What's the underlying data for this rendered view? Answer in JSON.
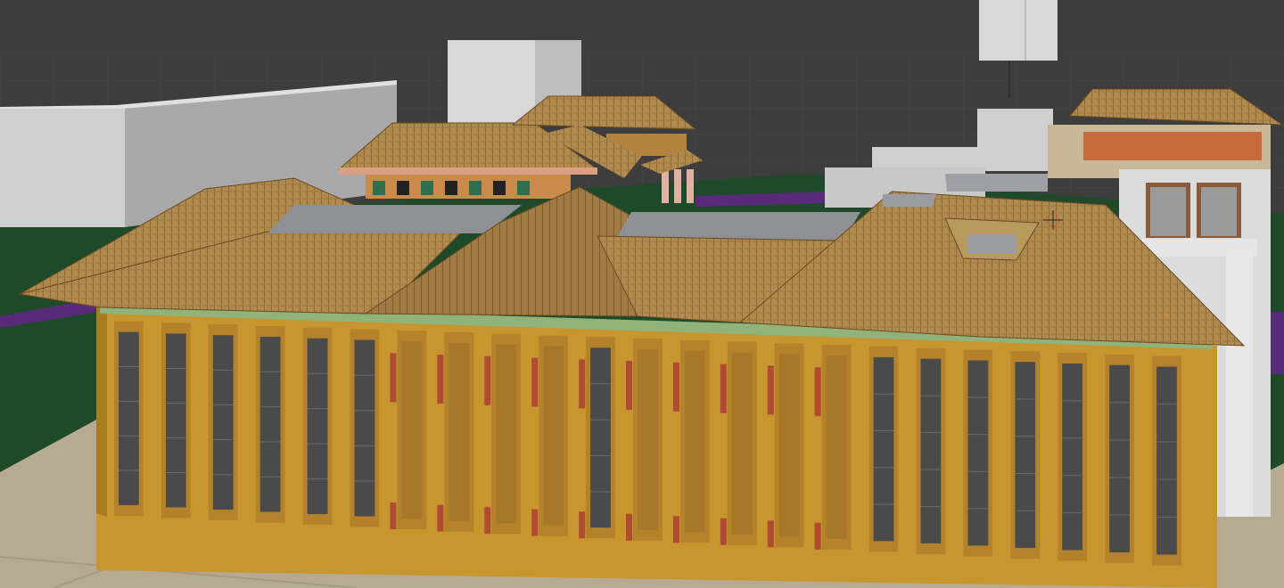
{
  "app": {
    "name": "3D viewport"
  },
  "viewport": {
    "background_color": "#3d3d3d",
    "grid_color": "#4a4a4a",
    "ground_color": "#1f4a2a",
    "pavement_color": "#b7aa93",
    "path_color": "#5a2a7a",
    "placeholder_block_color": "#c8c8c8"
  },
  "model": {
    "roof_color": "#b08a4e",
    "wall_color": "#c8962e",
    "pillar_accent_color": "#b04a32",
    "window_color": "#4a4a4a",
    "trim_color": "#8fb37a",
    "tower_wall_color": "#d8d8d8",
    "tower_beam_color": "#c86a3a"
  },
  "cursor": {
    "icon": "3d-cursor-icon",
    "ring_color": "#e05a2a"
  }
}
